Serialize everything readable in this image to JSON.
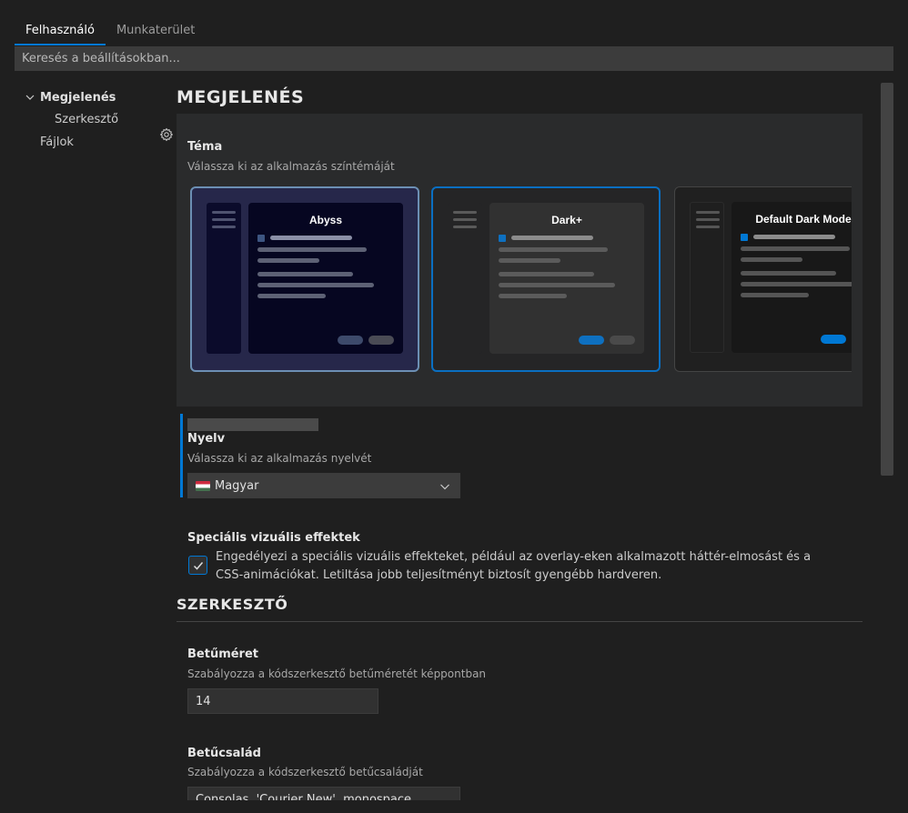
{
  "tabs": [
    {
      "label": "Felhasználó",
      "active": true
    },
    {
      "label": "Munkaterület",
      "active": false
    }
  ],
  "search": {
    "placeholder": "Keresés a beállításokban..."
  },
  "tree": {
    "items": [
      {
        "label": "Megjelenés",
        "expanded": true,
        "bold": true
      },
      {
        "label": "Szerkesztő",
        "bold": false
      },
      {
        "label": "Fájlok",
        "bold": false
      }
    ]
  },
  "sections": {
    "appearance": {
      "title": "MEGJELENÉS",
      "theme": {
        "name": "Téma",
        "desc": "Válassza ki az alkalmazás színtémáját",
        "cards": [
          {
            "name": "Abyss",
            "selected": false,
            "bg": "#26274a",
            "window": "#060621",
            "sidebar": "#0b0b2b",
            "accent": "#3d5581",
            "line": "#5d6175",
            "button": "#3d4a6b"
          },
          {
            "name": "Dark+",
            "selected": true,
            "bg": "#252526",
            "window": "#313131",
            "sidebar": "#252526",
            "accent": "#0e70c0",
            "line": "#5b5b5b",
            "button": "#0e70c0"
          },
          {
            "name": "Default Dark Modern",
            "selected": false,
            "bg": "#202020",
            "window": "#181818",
            "sidebar": "#1f1f1f",
            "accent": "#0078d4",
            "line": "#555555",
            "button": "#0078d4"
          }
        ]
      },
      "language": {
        "name": "Nyelv",
        "desc": "Válassza ki az alkalmazás nyelvét",
        "value": "Magyar"
      },
      "effects": {
        "name": "Speciális vizuális effektek",
        "checked": true,
        "desc": "Engedélyezi a speciális vizuális effekteket, például az overlay-eken alkalmazott háttér-elmosást és a CSS-animációkat. Letiltása jobb teljesítményt biztosít gyengébb hardveren."
      }
    },
    "editor": {
      "title": "SZERKESZTŐ",
      "font_size": {
        "name": "Betűméret",
        "desc": "Szabályozza a kódszerkesztő betűméretét képpontban",
        "value": "14"
      },
      "font_family": {
        "name": "Betűcsalád",
        "desc": "Szabályozza a kódszerkesztő betűcsaládját",
        "value": "Consolas, 'Courier New', monospace"
      }
    }
  },
  "colors": {
    "accent": "#0078d4",
    "background": "#1f1f1f",
    "panel": "#2a2b2c"
  },
  "icons": {
    "tree_expander": "chevron-down-icon",
    "setting_menu": "gear-icon",
    "select_arrow": "chevron-down-icon",
    "checkbox": "check-icon"
  }
}
